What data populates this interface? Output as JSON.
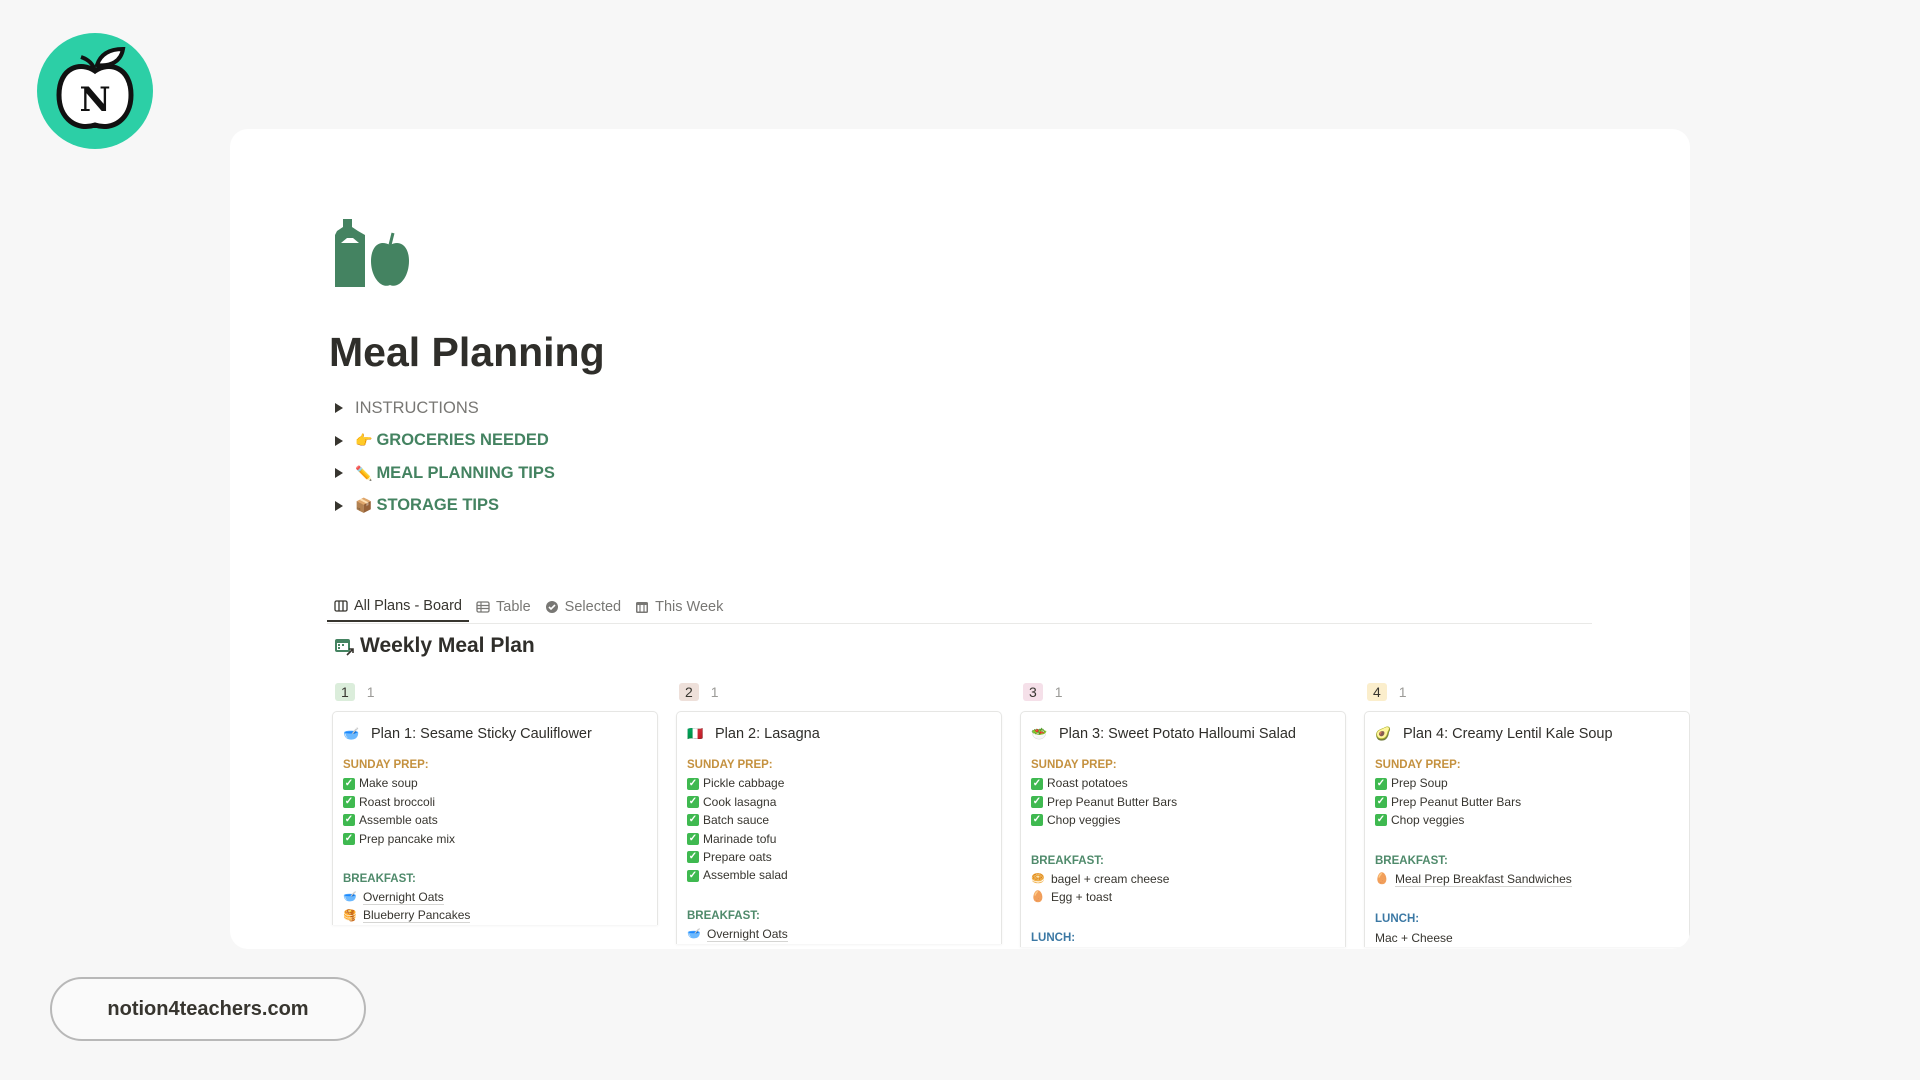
{
  "brand": {
    "logo_letter": "N",
    "logo_color": "#2ccfa6",
    "website": "notion4teachers.com"
  },
  "page": {
    "icon": "grocery-bottle-apple-icon",
    "title": "Meal Planning",
    "toggles": [
      {
        "label": "INSTRUCTIONS",
        "emoji": "",
        "style": "gray"
      },
      {
        "label": "GROCERIES NEEDED",
        "emoji": "👉",
        "style": "green"
      },
      {
        "label": "MEAL PLANNING TIPS",
        "emoji": "✏️",
        "style": "green"
      },
      {
        "label": "STORAGE TIPS",
        "emoji": "📦",
        "style": "green"
      }
    ]
  },
  "views": {
    "tabs": [
      {
        "label": "All Plans - Board",
        "icon": "board-icon",
        "active": true
      },
      {
        "label": "Table",
        "icon": "table-icon",
        "active": false
      },
      {
        "label": "Selected",
        "icon": "verified-check-icon",
        "active": false
      },
      {
        "label": "This Week",
        "icon": "calendar-icon",
        "active": false
      }
    ]
  },
  "database": {
    "title": "Weekly Meal Plan",
    "icon": "calendar-link-icon",
    "colors": {
      "sunday_prep": "#c4913f",
      "breakfast": "#4f8a6b",
      "lunch": "#3b78a4"
    },
    "groups": [
      {
        "label": "1",
        "count": "1",
        "badge_color": "#dbeddb",
        "card": {
          "emoji": "🥣",
          "title": "Plan 1: Sesame Sticky Cauliflower",
          "sections": [
            {
              "label": "SUNDAY PREP:",
              "kind": "sunday_prep",
              "items": [
                {
                  "text": "Make soup",
                  "icon": "check"
                },
                {
                  "text": "Roast broccoli",
                  "icon": "check"
                },
                {
                  "text": "Assemble oats",
                  "icon": "check"
                },
                {
                  "text": "Prep pancake mix",
                  "icon": "check"
                }
              ]
            },
            {
              "label": "BREAKFAST:",
              "kind": "breakfast",
              "items": [
                {
                  "text": "Overnight Oats",
                  "icon": "🥣",
                  "link": true
                },
                {
                  "text": "Blueberry Pancakes",
                  "icon": "🥞",
                  "link": true
                }
              ]
            }
          ]
        }
      },
      {
        "label": "2",
        "count": "1",
        "badge_color": "#eee0da",
        "card": {
          "emoji": "🇮🇹",
          "title": "Plan 2: Lasagna",
          "sections": [
            {
              "label": "SUNDAY PREP:",
              "kind": "sunday_prep",
              "items": [
                {
                  "text": "Pickle cabbage",
                  "icon": "check"
                },
                {
                  "text": "Cook lasagna",
                  "icon": "check"
                },
                {
                  "text": "Batch sauce",
                  "icon": "check"
                },
                {
                  "text": "Marinade tofu",
                  "icon": "check"
                },
                {
                  "text": "Prepare oats",
                  "icon": "check"
                },
                {
                  "text": "Assemble salad",
                  "icon": "check"
                }
              ]
            },
            {
              "label": "BREAKFAST:",
              "kind": "breakfast",
              "items": [
                {
                  "text": "Overnight Oats",
                  "icon": "🥣",
                  "link": true
                }
              ]
            }
          ]
        }
      },
      {
        "label": "3",
        "count": "1",
        "badge_color": "#f5e0e9",
        "card": {
          "emoji": "🥗",
          "title": "Plan 3: Sweet Potato Halloumi Salad",
          "sections": [
            {
              "label": "SUNDAY PREP:",
              "kind": "sunday_prep",
              "items": [
                {
                  "text": "Roast potatoes",
                  "icon": "check"
                },
                {
                  "text": "Prep Peanut Butter Bars",
                  "icon": "check"
                },
                {
                  "text": "Chop veggies",
                  "icon": "check"
                }
              ]
            },
            {
              "label": "BREAKFAST:",
              "kind": "breakfast",
              "items": [
                {
                  "text": "bagel + cream cheese",
                  "icon": "🥯"
                },
                {
                  "text": "Egg + toast",
                  "icon": "🥚"
                }
              ]
            },
            {
              "label": "LUNCH:",
              "kind": "lunch",
              "items": []
            }
          ]
        }
      },
      {
        "label": "4",
        "count": "1",
        "badge_color": "#fbeecc",
        "card": {
          "emoji": "🥑",
          "title": "Plan 4: Creamy Lentil Kale Soup",
          "sections": [
            {
              "label": "SUNDAY PREP:",
              "kind": "sunday_prep",
              "items": [
                {
                  "text": "Prep Soup",
                  "icon": "check"
                },
                {
                  "text": "Prep Peanut Butter Bars",
                  "icon": "check"
                },
                {
                  "text": "Chop veggies",
                  "icon": "check"
                }
              ]
            },
            {
              "label": "BREAKFAST:",
              "kind": "breakfast",
              "items": [
                {
                  "text": "Meal Prep Breakfast Sandwiches",
                  "icon": "🥚",
                  "link": true
                }
              ]
            },
            {
              "label": "LUNCH:",
              "kind": "lunch",
              "items": [
                {
                  "text": "Mac + Cheese",
                  "icon": ""
                }
              ]
            }
          ]
        }
      }
    ]
  }
}
